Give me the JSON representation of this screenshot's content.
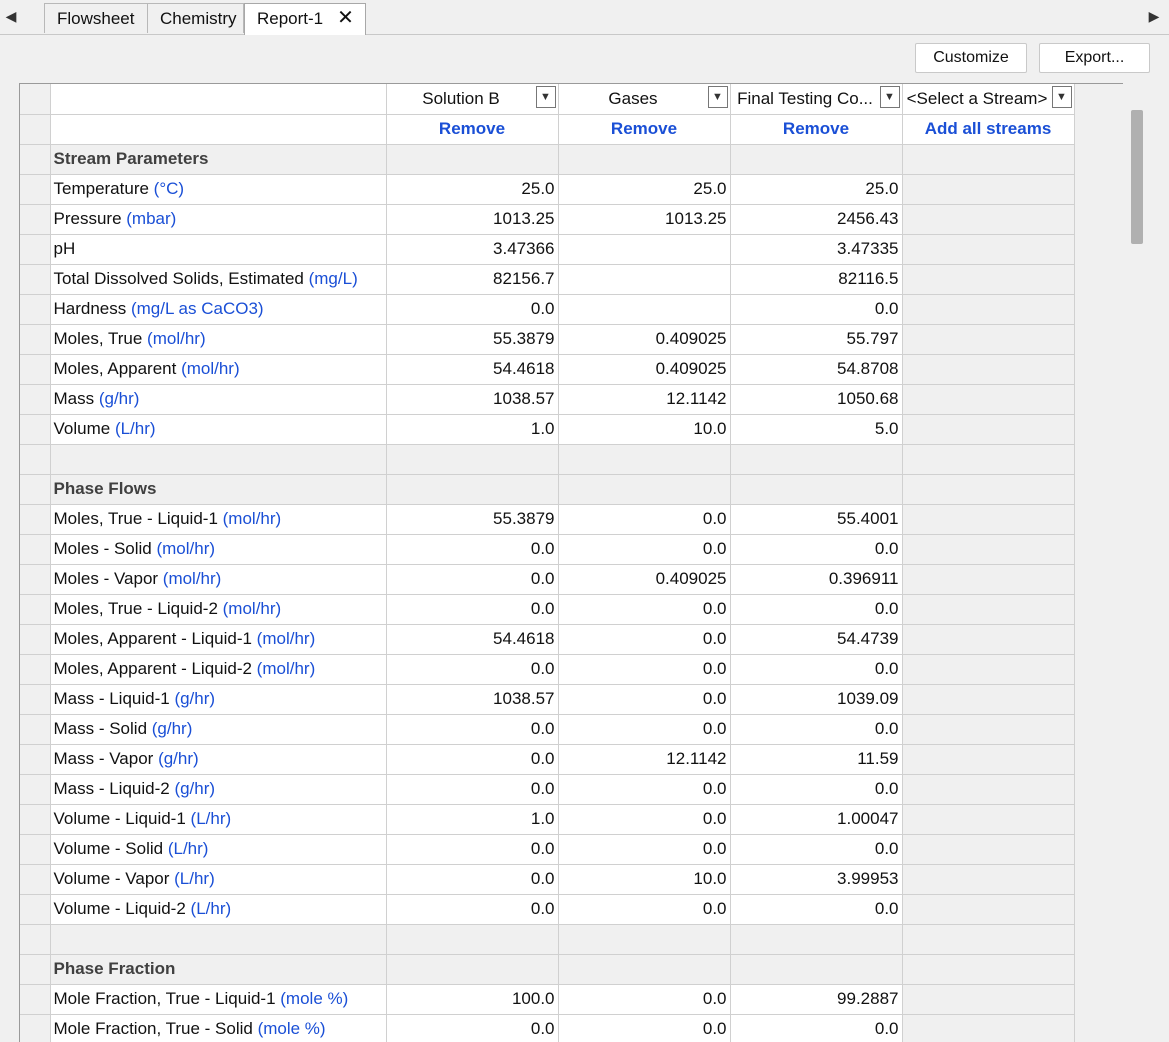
{
  "tabs": [
    {
      "label": "Flowsheet"
    },
    {
      "label": "Chemistry"
    },
    {
      "label": "Report-1",
      "active": true
    }
  ],
  "toolbar": {
    "customize_label": "Customize",
    "export_label": "Export..."
  },
  "columns": [
    {
      "stream": "Solution B",
      "action": "Remove"
    },
    {
      "stream": "Gases",
      "action": "Remove"
    },
    {
      "stream": "Final Testing Co...",
      "action": "Remove"
    },
    {
      "stream": "<Select a Stream>",
      "action": "Add all streams"
    }
  ],
  "sections": [
    {
      "title": "Stream Parameters",
      "rows": [
        {
          "label": "Temperature ",
          "unit": "(°C)",
          "values": [
            "25.0",
            "25.0",
            "25.0"
          ]
        },
        {
          "label": "Pressure ",
          "unit": "(mbar)",
          "values": [
            "1013.25",
            "1013.25",
            "2456.43"
          ]
        },
        {
          "label": "pH",
          "unit": "",
          "values": [
            "3.47366",
            "",
            "3.47335"
          ]
        },
        {
          "label": "Total Dissolved Solids, Estimated ",
          "unit": "(mg/L)",
          "values": [
            "82156.7",
            "",
            "82116.5"
          ]
        },
        {
          "label": "Hardness ",
          "unit": "(mg/L as CaCO3)",
          "values": [
            "0.0",
            "",
            "0.0"
          ]
        },
        {
          "label": "Moles, True ",
          "unit": "(mol/hr)",
          "values": [
            "55.3879",
            "0.409025",
            "55.797"
          ]
        },
        {
          "label": "Moles, Apparent ",
          "unit": "(mol/hr)",
          "values": [
            "54.4618",
            "0.409025",
            "54.8708"
          ]
        },
        {
          "label": "Mass ",
          "unit": "(g/hr)",
          "values": [
            "1038.57",
            "12.1142",
            "1050.68"
          ]
        },
        {
          "label": "Volume ",
          "unit": "(L/hr)",
          "values": [
            "1.0",
            "10.0",
            "5.0"
          ]
        }
      ]
    },
    {
      "title": "Phase Flows",
      "rows": [
        {
          "label": "Moles, True - Liquid-1 ",
          "unit": "(mol/hr)",
          "values": [
            "55.3879",
            "0.0",
            "55.4001"
          ]
        },
        {
          "label": "Moles - Solid ",
          "unit": "(mol/hr)",
          "values": [
            "0.0",
            "0.0",
            "0.0"
          ]
        },
        {
          "label": "Moles - Vapor ",
          "unit": "(mol/hr)",
          "values": [
            "0.0",
            "0.409025",
            "0.396911"
          ]
        },
        {
          "label": "Moles, True - Liquid-2 ",
          "unit": "(mol/hr)",
          "values": [
            "0.0",
            "0.0",
            "0.0"
          ]
        },
        {
          "label": "Moles, Apparent - Liquid-1 ",
          "unit": "(mol/hr)",
          "values": [
            "54.4618",
            "0.0",
            "54.4739"
          ]
        },
        {
          "label": "Moles, Apparent - Liquid-2 ",
          "unit": "(mol/hr)",
          "values": [
            "0.0",
            "0.0",
            "0.0"
          ]
        },
        {
          "label": "Mass - Liquid-1 ",
          "unit": "(g/hr)",
          "values": [
            "1038.57",
            "0.0",
            "1039.09"
          ]
        },
        {
          "label": "Mass - Solid ",
          "unit": "(g/hr)",
          "values": [
            "0.0",
            "0.0",
            "0.0"
          ]
        },
        {
          "label": "Mass - Vapor ",
          "unit": "(g/hr)",
          "values": [
            "0.0",
            "12.1142",
            "11.59"
          ]
        },
        {
          "label": "Mass - Liquid-2 ",
          "unit": "(g/hr)",
          "values": [
            "0.0",
            "0.0",
            "0.0"
          ]
        },
        {
          "label": "Volume - Liquid-1 ",
          "unit": "(L/hr)",
          "values": [
            "1.0",
            "0.0",
            "1.00047"
          ]
        },
        {
          "label": "Volume - Solid ",
          "unit": "(L/hr)",
          "values": [
            "0.0",
            "0.0",
            "0.0"
          ]
        },
        {
          "label": "Volume - Vapor ",
          "unit": "(L/hr)",
          "values": [
            "0.0",
            "10.0",
            "3.99953"
          ]
        },
        {
          "label": "Volume - Liquid-2 ",
          "unit": "(L/hr)",
          "values": [
            "0.0",
            "0.0",
            "0.0"
          ]
        }
      ]
    },
    {
      "title": "Phase Fraction",
      "rows": [
        {
          "label": "Mole Fraction, True - Liquid-1 ",
          "unit": "(mole %)",
          "values": [
            "100.0",
            "0.0",
            "99.2887"
          ]
        },
        {
          "label": "Mole Fraction, True - Solid ",
          "unit": "(mole %)",
          "values": [
            "0.0",
            "0.0",
            "0.0"
          ]
        }
      ]
    }
  ],
  "icons": {
    "scroll_left": "chevron-left-icon",
    "scroll_right": "chevron-right-icon",
    "close": "close-icon",
    "dropdown": "chevron-down-icon"
  }
}
